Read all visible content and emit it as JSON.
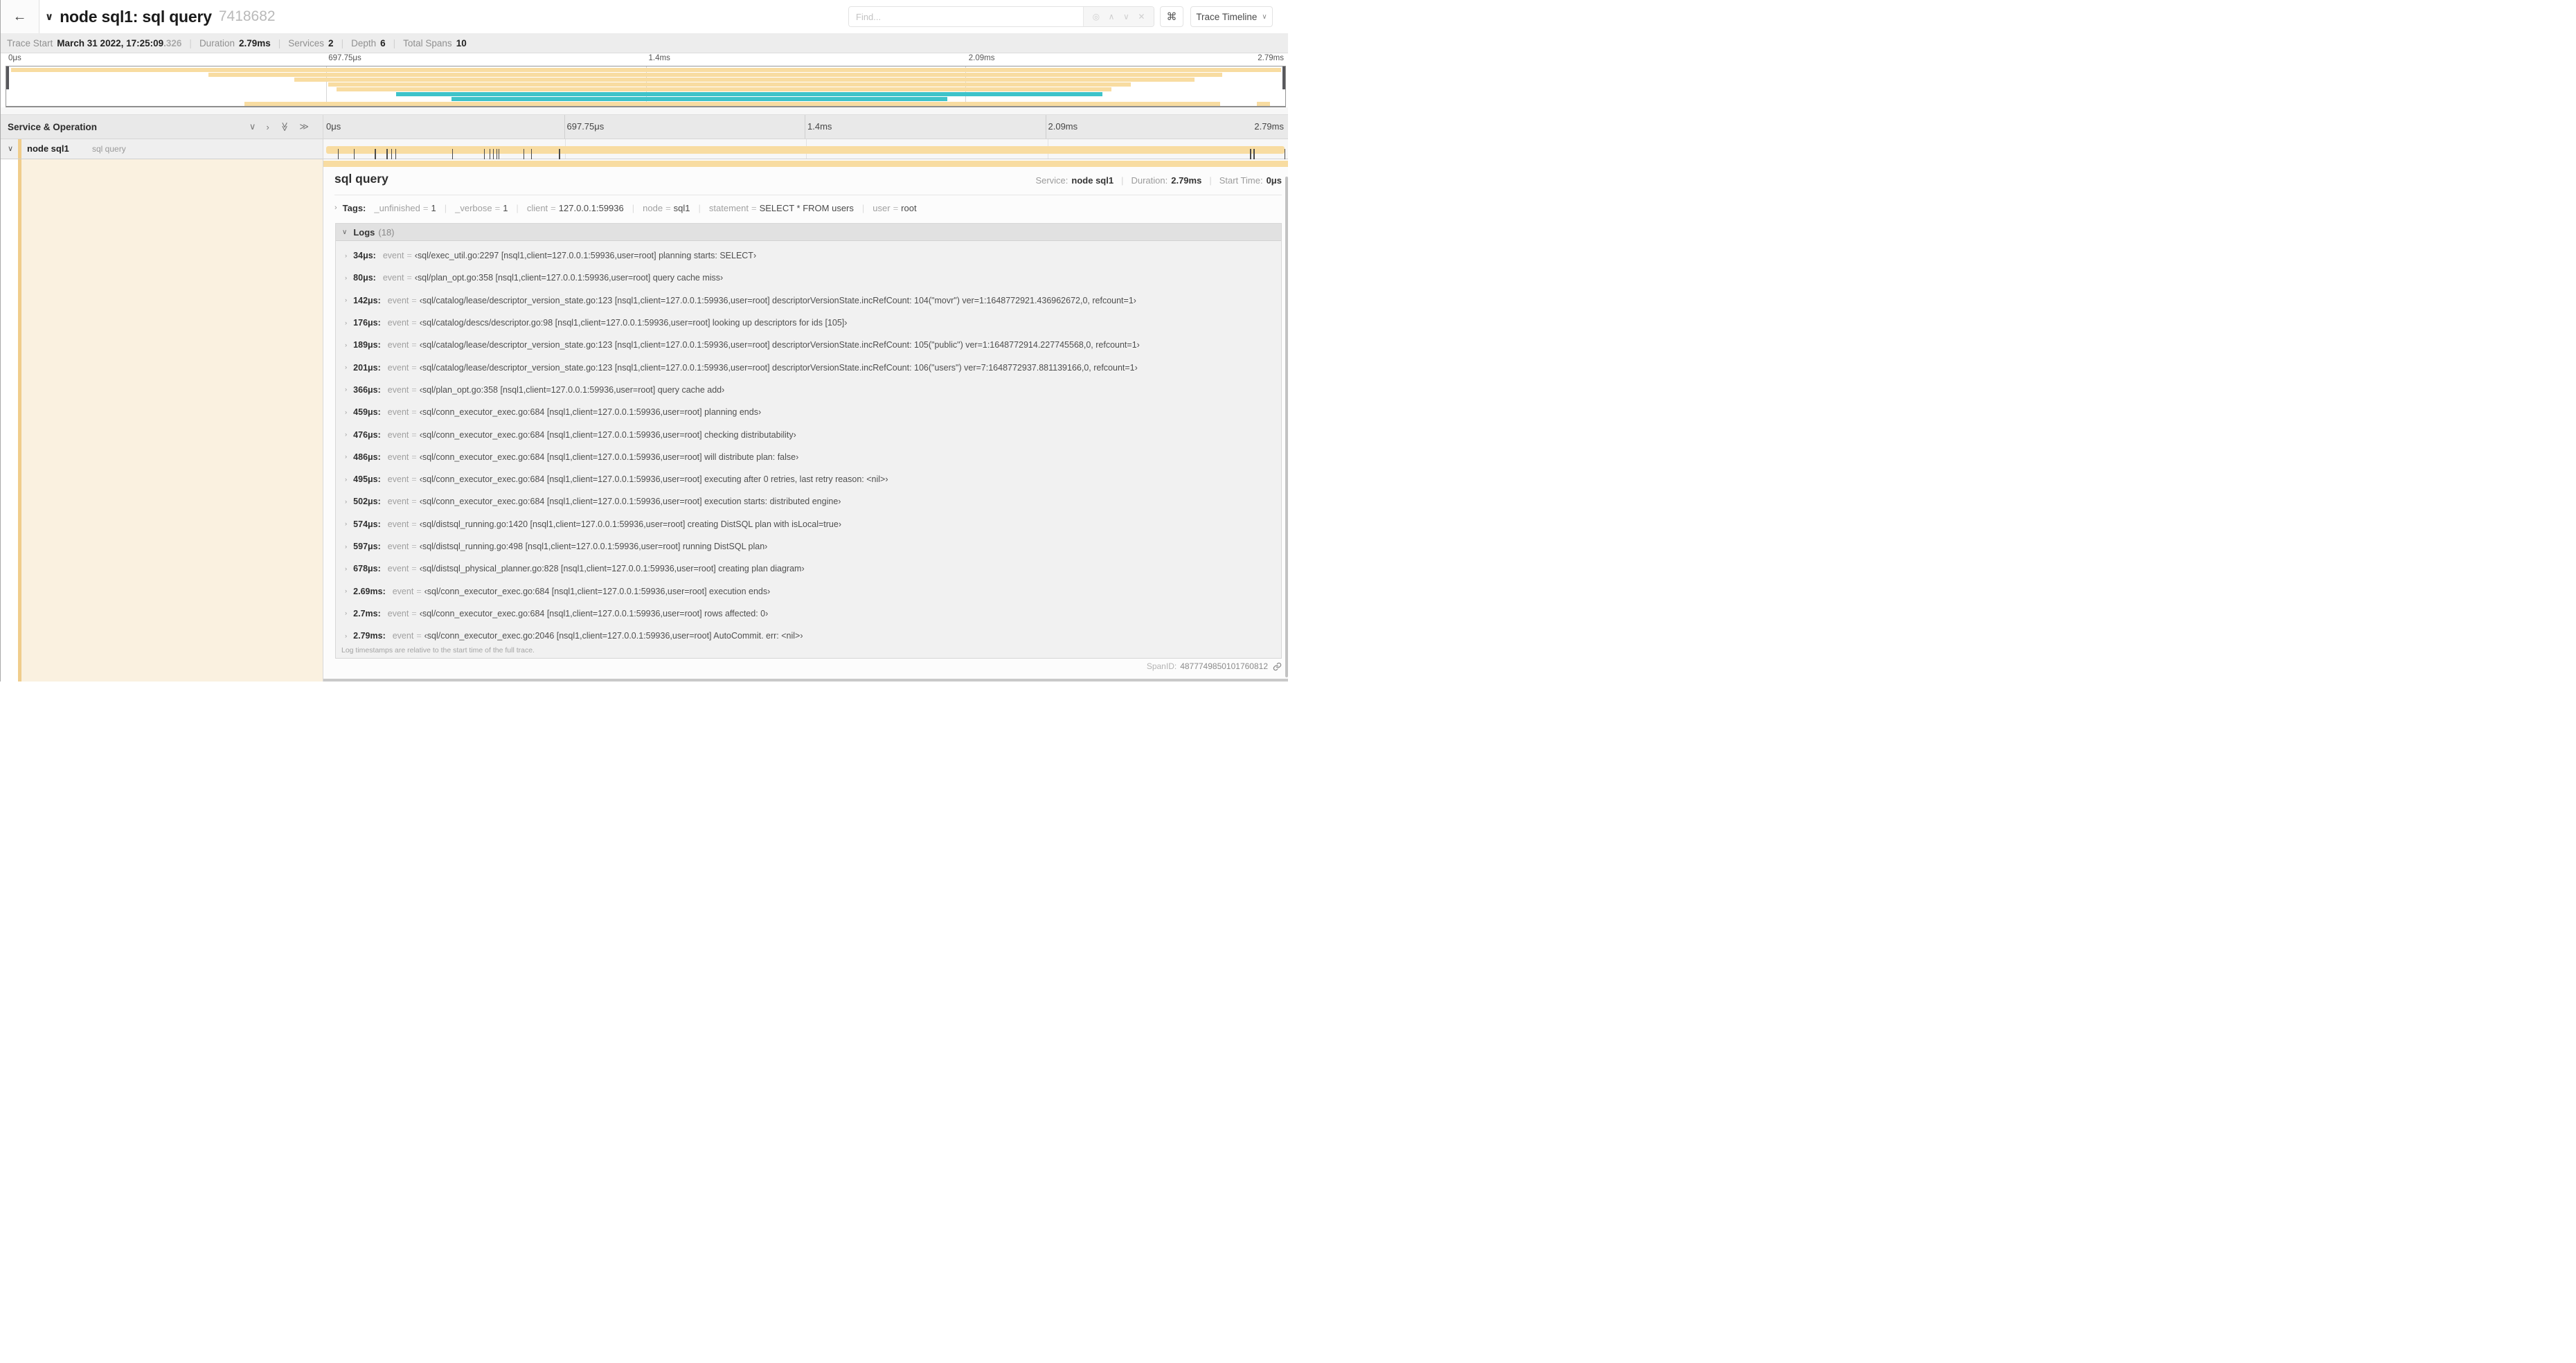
{
  "nav": {
    "back": "←",
    "title": "node sql1: sql query",
    "trace_id": "7418682",
    "find_placeholder": "Find...",
    "shortcut": "⌘",
    "view_button": "Trace Timeline"
  },
  "meta": {
    "items": [
      {
        "label": "Trace Start",
        "value": "March 31 2022, 17:25:09",
        "suffix": ".326"
      },
      {
        "label": "Duration",
        "value": "2.79ms"
      },
      {
        "label": "Services",
        "value": "2"
      },
      {
        "label": "Depth",
        "value": "6"
      },
      {
        "label": "Total Spans",
        "value": "10"
      }
    ]
  },
  "timeline": {
    "duration_us": 2790,
    "ticks": [
      {
        "label": "0μs",
        "pos": 0
      },
      {
        "label": "697.75μs",
        "pos": 0.25
      },
      {
        "label": "1.4ms",
        "pos": 0.5
      },
      {
        "label": "2.09ms",
        "pos": 0.75
      },
      {
        "label": "2.79ms",
        "pos": 1
      }
    ]
  },
  "minimap": {
    "rows": [
      [
        {
          "s": 0.004,
          "e": 0.997,
          "c": "tan"
        }
      ],
      [
        {
          "s": 0.158,
          "e": 0.951,
          "c": "tan"
        }
      ],
      [
        {
          "s": 0.225,
          "e": 0.929,
          "c": "tan"
        }
      ],
      [
        {
          "s": 0.252,
          "e": 0.879,
          "c": "tan"
        }
      ],
      [
        {
          "s": 0.258,
          "e": 0.864,
          "c": "tan"
        }
      ],
      [
        {
          "s": 0.305,
          "e": 0.857,
          "c": "teal"
        }
      ],
      [
        {
          "s": 0.348,
          "e": 0.736,
          "c": "teal"
        }
      ],
      [
        {
          "s": 0.186,
          "e": 0.949,
          "c": "tan"
        },
        {
          "s": 0.978,
          "e": 0.988,
          "c": "tan"
        }
      ]
    ]
  },
  "sidebar": {
    "header": "Service & Operation",
    "service": "node sql1",
    "operation": "sql query"
  },
  "detail": {
    "title": "sql query",
    "head_meta": [
      {
        "label": "Service:",
        "value": "node sql1"
      },
      {
        "label": "Duration:",
        "value": "2.79ms"
      },
      {
        "label": "Start Time:",
        "value": "0μs"
      }
    ],
    "tags_label": "Tags:",
    "tags": [
      {
        "key": "_unfinished",
        "value": "1"
      },
      {
        "key": "_verbose",
        "value": "1"
      },
      {
        "key": "client",
        "value": "127.0.0.1:59936"
      },
      {
        "key": "node",
        "value": "sql1"
      },
      {
        "key": "statement",
        "value": "SELECT * FROM users"
      },
      {
        "key": "user",
        "value": "root"
      }
    ],
    "logs_label": "Logs",
    "logs_count": "(18)",
    "event_key": "event",
    "logs": [
      {
        "t": "34μs",
        "v": "‹sql/exec_util.go:2297 [nsql1,client=127.0.0.1:59936,user=root] planning starts: SELECT›"
      },
      {
        "t": "80μs",
        "v": "‹sql/plan_opt.go:358 [nsql1,client=127.0.0.1:59936,user=root] query cache miss›"
      },
      {
        "t": "142μs",
        "v": "‹sql/catalog/lease/descriptor_version_state.go:123 [nsql1,client=127.0.0.1:59936,user=root] descriptorVersionState.incRefCount: 104(\"movr\") ver=1:1648772921.436962672,0, refcount=1›"
      },
      {
        "t": "176μs",
        "v": "‹sql/catalog/descs/descriptor.go:98 [nsql1,client=127.0.0.1:59936,user=root] looking up descriptors for ids [105]›"
      },
      {
        "t": "189μs",
        "v": "‹sql/catalog/lease/descriptor_version_state.go:123 [nsql1,client=127.0.0.1:59936,user=root] descriptorVersionState.incRefCount: 105(\"public\") ver=1:1648772914.227745568,0, refcount=1›"
      },
      {
        "t": "201μs",
        "v": "‹sql/catalog/lease/descriptor_version_state.go:123 [nsql1,client=127.0.0.1:59936,user=root] descriptorVersionState.incRefCount: 106(\"users\") ver=7:1648772937.881139166,0, refcount=1›"
      },
      {
        "t": "366μs",
        "v": "‹sql/plan_opt.go:358 [nsql1,client=127.0.0.1:59936,user=root] query cache add›"
      },
      {
        "t": "459μs",
        "v": "‹sql/conn_executor_exec.go:684 [nsql1,client=127.0.0.1:59936,user=root] planning ends›"
      },
      {
        "t": "476μs",
        "v": "‹sql/conn_executor_exec.go:684 [nsql1,client=127.0.0.1:59936,user=root] checking distributability›"
      },
      {
        "t": "486μs",
        "v": "‹sql/conn_executor_exec.go:684 [nsql1,client=127.0.0.1:59936,user=root] will distribute plan: false›"
      },
      {
        "t": "495μs",
        "v": "‹sql/conn_executor_exec.go:684 [nsql1,client=127.0.0.1:59936,user=root] executing after 0 retries, last retry reason: <nil>›"
      },
      {
        "t": "502μs",
        "v": "‹sql/conn_executor_exec.go:684 [nsql1,client=127.0.0.1:59936,user=root] execution starts: distributed engine›"
      },
      {
        "t": "574μs",
        "v": "‹sql/distsql_running.go:1420 [nsql1,client=127.0.0.1:59936,user=root] creating DistSQL plan with isLocal=true›"
      },
      {
        "t": "597μs",
        "v": "‹sql/distsql_running.go:498 [nsql1,client=127.0.0.1:59936,user=root] running DistSQL plan›"
      },
      {
        "t": "678μs",
        "v": "‹sql/distsql_physical_planner.go:828 [nsql1,client=127.0.0.1:59936,user=root] creating plan diagram›"
      },
      {
        "t": "2.69ms",
        "v": "‹sql/conn_executor_exec.go:684 [nsql1,client=127.0.0.1:59936,user=root] execution ends›"
      },
      {
        "t": "2.7ms",
        "v": "‹sql/conn_executor_exec.go:684 [nsql1,client=127.0.0.1:59936,user=root] rows affected: 0›"
      },
      {
        "t": "2.79ms",
        "v": "‹sql/conn_executor_exec.go:2046 [nsql1,client=127.0.0.1:59936,user=root] AutoCommit. err: <nil>›"
      }
    ],
    "note": "Log timestamps are relative to the start time of the full trace.",
    "footer_label": "SpanID:",
    "span_id": "4877749850101760812"
  },
  "colors": {
    "tan": "#F8DCA1",
    "teal": "#3EC3C9",
    "cream": "#FAF1E0",
    "accent": "#F0CD8C"
  }
}
